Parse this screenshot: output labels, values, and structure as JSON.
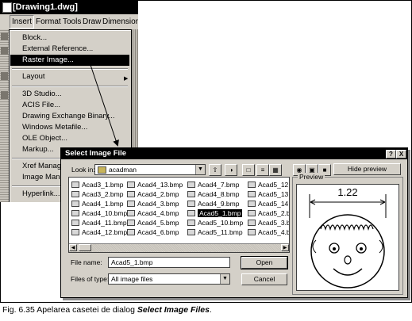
{
  "app": {
    "window_title": "[Drawing1.dwg]"
  },
  "menubar": [
    "Insert",
    "Format",
    "Tools",
    "Draw",
    "Dimension"
  ],
  "insert_menu": {
    "items": [
      {
        "label": "Block...",
        "group": 1
      },
      {
        "label": "External Reference...",
        "group": 1
      },
      {
        "label": "Raster Image...",
        "group": 1,
        "selected": true
      },
      {
        "label": "Layout",
        "group": 2,
        "submenu": true
      },
      {
        "label": "3D Studio...",
        "group": 3
      },
      {
        "label": "ACIS File...",
        "group": 3
      },
      {
        "label": "Drawing Exchange Binary...",
        "group": 3
      },
      {
        "label": "Windows Metafile...",
        "group": 3
      },
      {
        "label": "OLE Object...",
        "group": 3
      },
      {
        "label": "Markup...",
        "group": 3
      },
      {
        "label": "Xref Manager",
        "group": 4
      },
      {
        "label": "Image Manager",
        "group": 4
      },
      {
        "label": "Hyperlink...",
        "group": 5
      }
    ]
  },
  "dialog": {
    "title": "Select Image File",
    "title_buttons": [
      "?",
      "X"
    ],
    "look_in_label": "Look in:",
    "look_in_value": "acadman",
    "hide_preview_label": "Hide preview",
    "files_columns": [
      [
        "Acad3_1.bmp",
        "Acad3_2.bmp",
        "Acad4_1.bmp",
        "Acad4_10.bmp",
        "Acad4_11.bmp",
        "Acad4_12.bmp"
      ],
      [
        "Acad4_13.bmp",
        "Acad4_2.bmp",
        "Acad4_3.bmp",
        "Acad4_4.bmp",
        "Acad4_5.bmp",
        "Acad4_6.bmp"
      ],
      [
        "Acad4_7.bmp",
        "Acad4_8.bmp",
        "Acad4_9.bmp",
        "Acad5_1.bmp",
        "Acad5_10.bmp",
        "Acad5_11.bmp"
      ],
      [
        "Acad5_12.",
        "Acad5_13.",
        "Acad5_14.",
        "Acad5_2.b",
        "Acad5_3.b",
        "Acad5_4.b"
      ]
    ],
    "selected_file": "Acad5_1.bmp",
    "file_name_label": "File name:",
    "file_name_value": "Acad5_1.bmp",
    "files_of_type_label": "Files of type:",
    "files_of_type_value": "All image files",
    "open_label": "Open",
    "cancel_label": "Cancel",
    "preview_label": "Preview",
    "preview_dimension": "1.22"
  },
  "caption": {
    "prefix": "Fig. 6.35 Apelarea casetei de dialog ",
    "emphasis": "Select Image Files",
    "suffix": "."
  }
}
